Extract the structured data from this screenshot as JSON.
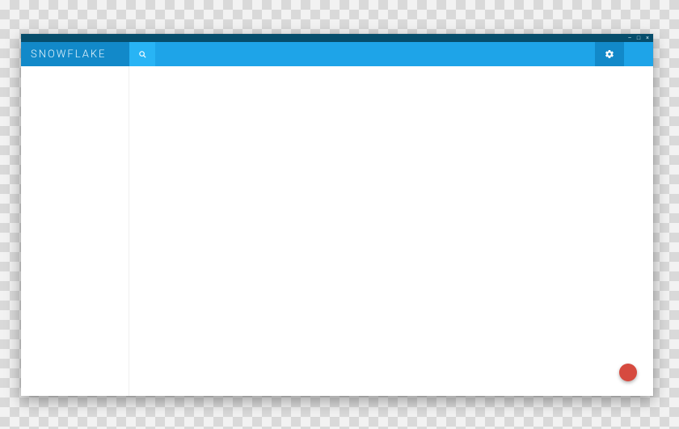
{
  "window": {
    "minimize_glyph": "–",
    "maximize_glyph": "□",
    "close_glyph": "×"
  },
  "header": {
    "brand": "SNOWFLAKE",
    "search_placeholder": "",
    "search_value": ""
  },
  "icons": {
    "search": "search-icon",
    "gear": "gear-icon"
  },
  "colors": {
    "titlebar": "#064d6b",
    "brand_bg": "#1289c9",
    "header_bg": "#1ea4e8",
    "search_btn_bg": "#28b4f5",
    "fab": "#d64a3f"
  }
}
